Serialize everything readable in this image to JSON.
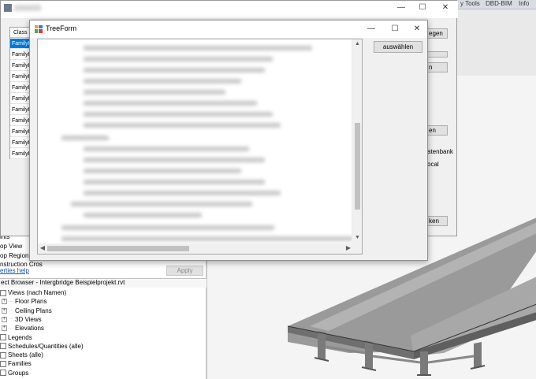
{
  "ribbon": {
    "tabs": [
      "y Tools",
      "DBD-BIM",
      "Info"
    ]
  },
  "background_form": {
    "column_header": "Class",
    "rows": [
      "FamilyIn",
      "FamilyIn",
      "FamilyIn",
      "FamilyIn",
      "FamilyIn",
      "FamilyIn",
      "FamilyIn",
      "FamilyIn",
      "FamilyIn",
      "FamilyIn",
      "FamilyIn"
    ],
    "selected_row_index": 0,
    "button_1": "egen",
    "button_2": "n",
    "button_3": "en",
    "button_4": "ken",
    "label_1": "atenbank",
    "label_2": "ocal",
    "minimize": "—",
    "maximize": "☐",
    "close": "✕"
  },
  "treeform": {
    "title": "TreeForm",
    "select_button": "auswählen",
    "minimize": "—",
    "maximize": "☐",
    "close": "✕"
  },
  "properties": {
    "rows": [
      "ints",
      "op View",
      "op Region V",
      "nstruction Cros"
    ],
    "help_link": "erties help",
    "apply": "Apply"
  },
  "project_browser": {
    "title": "ect Browser - Intergbridge Beispielprojekt.rvt",
    "items": [
      {
        "label": "Views (nach Namen)",
        "level": 0,
        "expander": "",
        "icon": "views-icon"
      },
      {
        "label": "Floor Plans",
        "level": 1,
        "expander": "+",
        "icon": ""
      },
      {
        "label": "Ceiling Plans",
        "level": 1,
        "expander": "+",
        "icon": ""
      },
      {
        "label": "3D Views",
        "level": 1,
        "expander": "+",
        "icon": ""
      },
      {
        "label": "Elevations",
        "level": 1,
        "expander": "+",
        "icon": ""
      },
      {
        "label": "Legends",
        "level": 0,
        "expander": "",
        "icon": "legends-icon"
      },
      {
        "label": "Schedules/Quantities (alle)",
        "level": 0,
        "expander": "",
        "icon": "schedules-icon"
      },
      {
        "label": "Sheets (alle)",
        "level": 0,
        "expander": "",
        "icon": "sheets-icon"
      },
      {
        "label": "Families",
        "level": 0,
        "expander": "",
        "icon": "families-icon"
      },
      {
        "label": "Groups",
        "level": 0,
        "expander": "",
        "icon": "groups-icon"
      }
    ]
  }
}
